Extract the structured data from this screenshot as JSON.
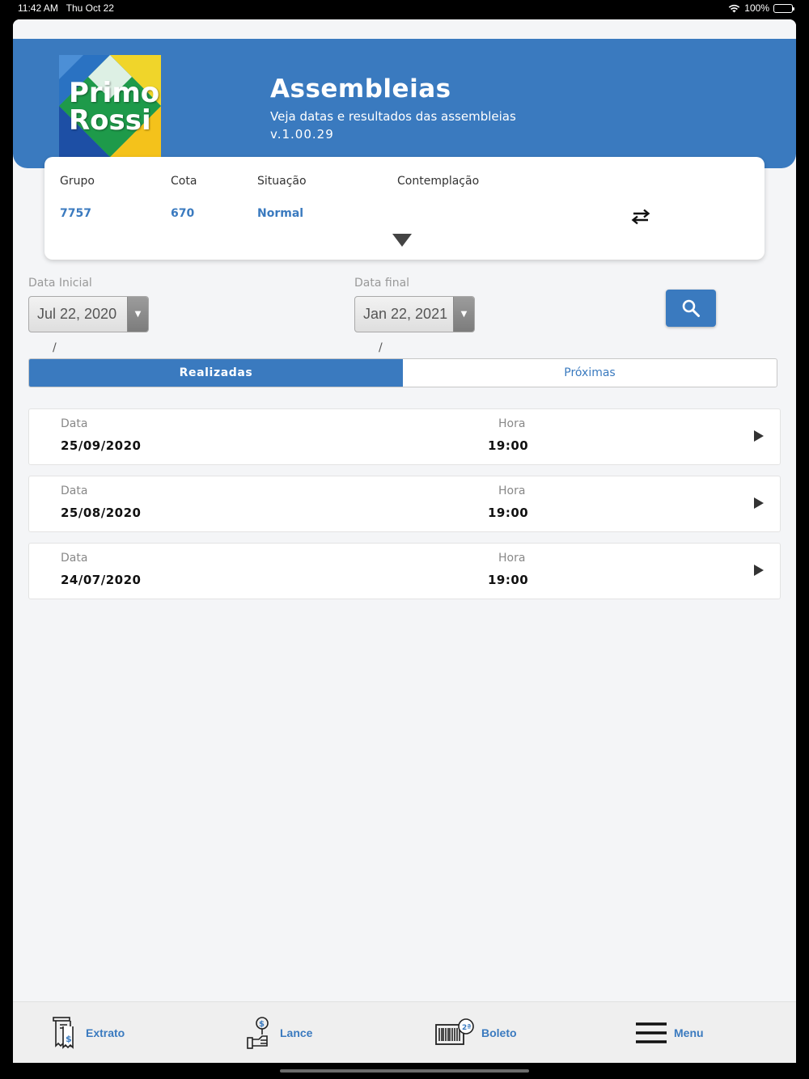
{
  "status_bar": {
    "time": "11:42 AM",
    "date": "Thu Oct 22",
    "battery": "100%"
  },
  "header": {
    "logo_line1": "Primo",
    "logo_line2": "Rossi",
    "title": "Assembleias",
    "subtitle": "Veja datas e resultados das assembleias",
    "version": "v.1.00.29",
    "bg_color": "#3a7abf"
  },
  "info_card": {
    "grupo_label": "Grupo",
    "grupo_value": "7757",
    "cota_label": "Cota",
    "cota_value": "670",
    "situacao_label": "Situação",
    "situacao_value": "Normal",
    "contemplacao_label": "Contemplação",
    "swap_icon": "swap-arrows-icon",
    "expand_icon": "triangle-down-icon"
  },
  "filters": {
    "start_label": "Data Inicial",
    "start_value": "Jul 22, 2020",
    "end_label": "Data final",
    "end_value": "Jan 22, 2021",
    "search_icon": "search-icon",
    "start_slash": "/",
    "end_slash": "/"
  },
  "tabs": [
    {
      "label": "Realizadas",
      "active": true
    },
    {
      "label": "Próximas",
      "active": false
    }
  ],
  "assemblies": {
    "date_label": "Data",
    "time_label": "Hora",
    "rows": [
      {
        "date": "25/09/2020",
        "time": "19:00"
      },
      {
        "date": "25/08/2020",
        "time": "19:00"
      },
      {
        "date": "24/07/2020",
        "time": "19:00"
      }
    ]
  },
  "bottom_nav": {
    "extrato": "Extrato",
    "lance": "Lance",
    "boleto": "Boleto",
    "menu": "Menu"
  }
}
